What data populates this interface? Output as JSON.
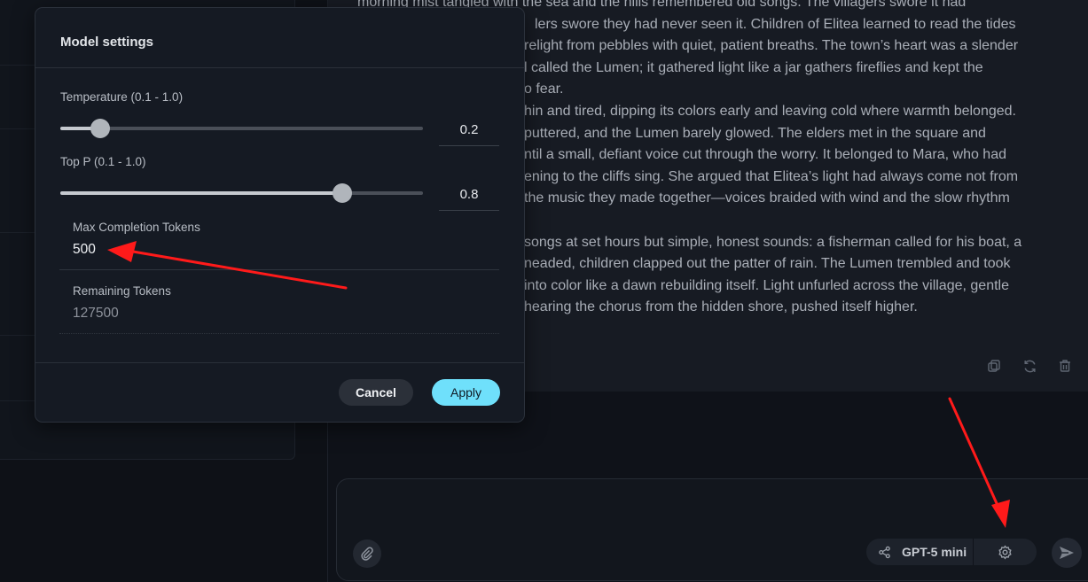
{
  "chat": {
    "paragraphs": [
      "morning mist tangled with the sea and the hills remembered old songs. The villagers swore it had",
      "lers swore they had never seen it. Children of Elitea learned to read the tides",
      "relight from pebbles with quiet, patient breaths. The town’s heart was a slender",
      "l called the Lumen; it gathered light like a jar gathers fireflies and kept the",
      "o fear.",
      "hin and tired, dipping its colors early and leaving cold where warmth belonged.",
      "puttered, and the Lumen barely glowed. The elders met in the square and",
      "ntil a small, defiant voice cut through the worry. It belonged to Mara, who had",
      "ening to the cliffs sing. She argued that Elitea’s light had always come not from",
      "the music they made together—voices braided with wind and the slow rhythm",
      "",
      "songs at set hours but simple, honest sounds: a fisherman called for his boat, a",
      "neaded, children clapped out the patter of rain. The Lumen trembled and took",
      " into color like a dawn rebuilding itself. Light unfurled across the village, gentle",
      "hearing the chorus from the hidden shore, pushed itself higher."
    ],
    "actions": [
      "copy-icon",
      "regenerate-icon",
      "trash-icon"
    ]
  },
  "input": {
    "placeholder": "",
    "model_name": "GPT-5 mini"
  },
  "modal": {
    "title": "Model settings",
    "temperature": {
      "label": "Temperature (0.1 - 1.0)",
      "value": "0.2",
      "min": 0.1,
      "max": 1.0,
      "numeric": 0.2
    },
    "top_p": {
      "label": "Top P (0.1 - 1.0)",
      "value": "0.8",
      "min": 0.1,
      "max": 1.0,
      "numeric": 0.8
    },
    "max_tokens": {
      "label": "Max Completion Tokens",
      "value": "500"
    },
    "remaining": {
      "label": "Remaining Tokens",
      "value": "127500"
    },
    "cancel_label": "Cancel",
    "apply_label": "Apply"
  },
  "colors": {
    "accent": "#6fe0fb",
    "annotation": "#ff1a1a"
  }
}
